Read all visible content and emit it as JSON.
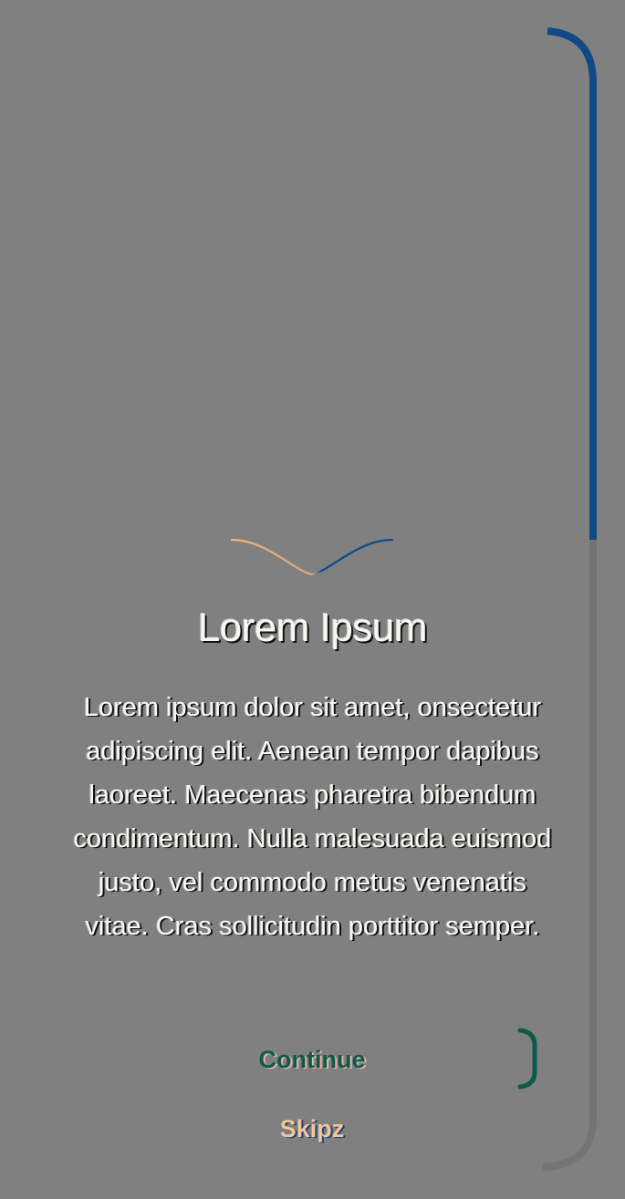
{
  "onboarding": {
    "title": "Lorem Ipsum",
    "description": "Lorem ipsum dolor sit amet, onsectetur adipiscing elit. Aenean tempor dapibus laoreet. Maecenas pharetra bibendum condimentum. Nulla malesuada euismod justo, vel commodo metus venenatis vitae. Cras sollicitudin porttitor semper.",
    "continue_label": "Continue",
    "skip_label": "Skipz"
  },
  "colors": {
    "background": "#808080",
    "frame_accent": "#0f4a86",
    "frame_muted": "#7a7a7a",
    "wave_left": "#f4b77a",
    "wave_right": "#0f4a86",
    "continue_text": "#0d5a4a",
    "skip_text": "#f1c79a"
  }
}
